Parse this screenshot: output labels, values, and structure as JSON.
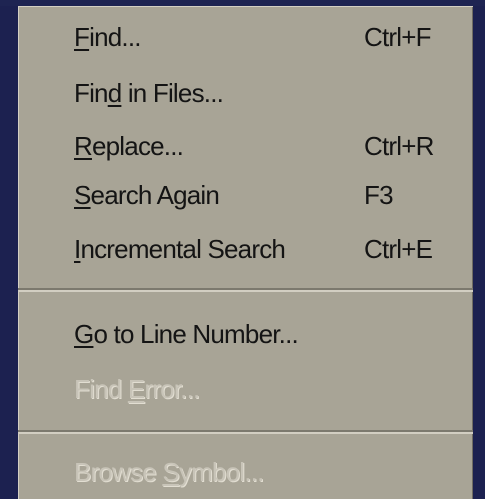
{
  "menu": {
    "items": [
      {
        "pre": "",
        "mnemonic": "F",
        "post": "ind...",
        "shortcut": "Ctrl+F"
      },
      {
        "pre": "Fin",
        "mnemonic": "d",
        "post": " in Files...",
        "shortcut": ""
      },
      {
        "pre": "",
        "mnemonic": "R",
        "post": "eplace...",
        "shortcut": "Ctrl+R"
      },
      {
        "pre": "",
        "mnemonic": "S",
        "post": "earch Again",
        "shortcut": "F3"
      },
      {
        "pre": "",
        "mnemonic": "I",
        "post": "ncremental Search",
        "shortcut": "Ctrl+E"
      },
      {
        "pre": "",
        "mnemonic": "G",
        "post": "o to Line Number...",
        "shortcut": ""
      },
      {
        "pre": "Find ",
        "mnemonic": "E",
        "post": "rror...",
        "shortcut": ""
      },
      {
        "pre": "Browse ",
        "mnemonic": "S",
        "post": "ymbol...",
        "shortcut": ""
      }
    ]
  }
}
